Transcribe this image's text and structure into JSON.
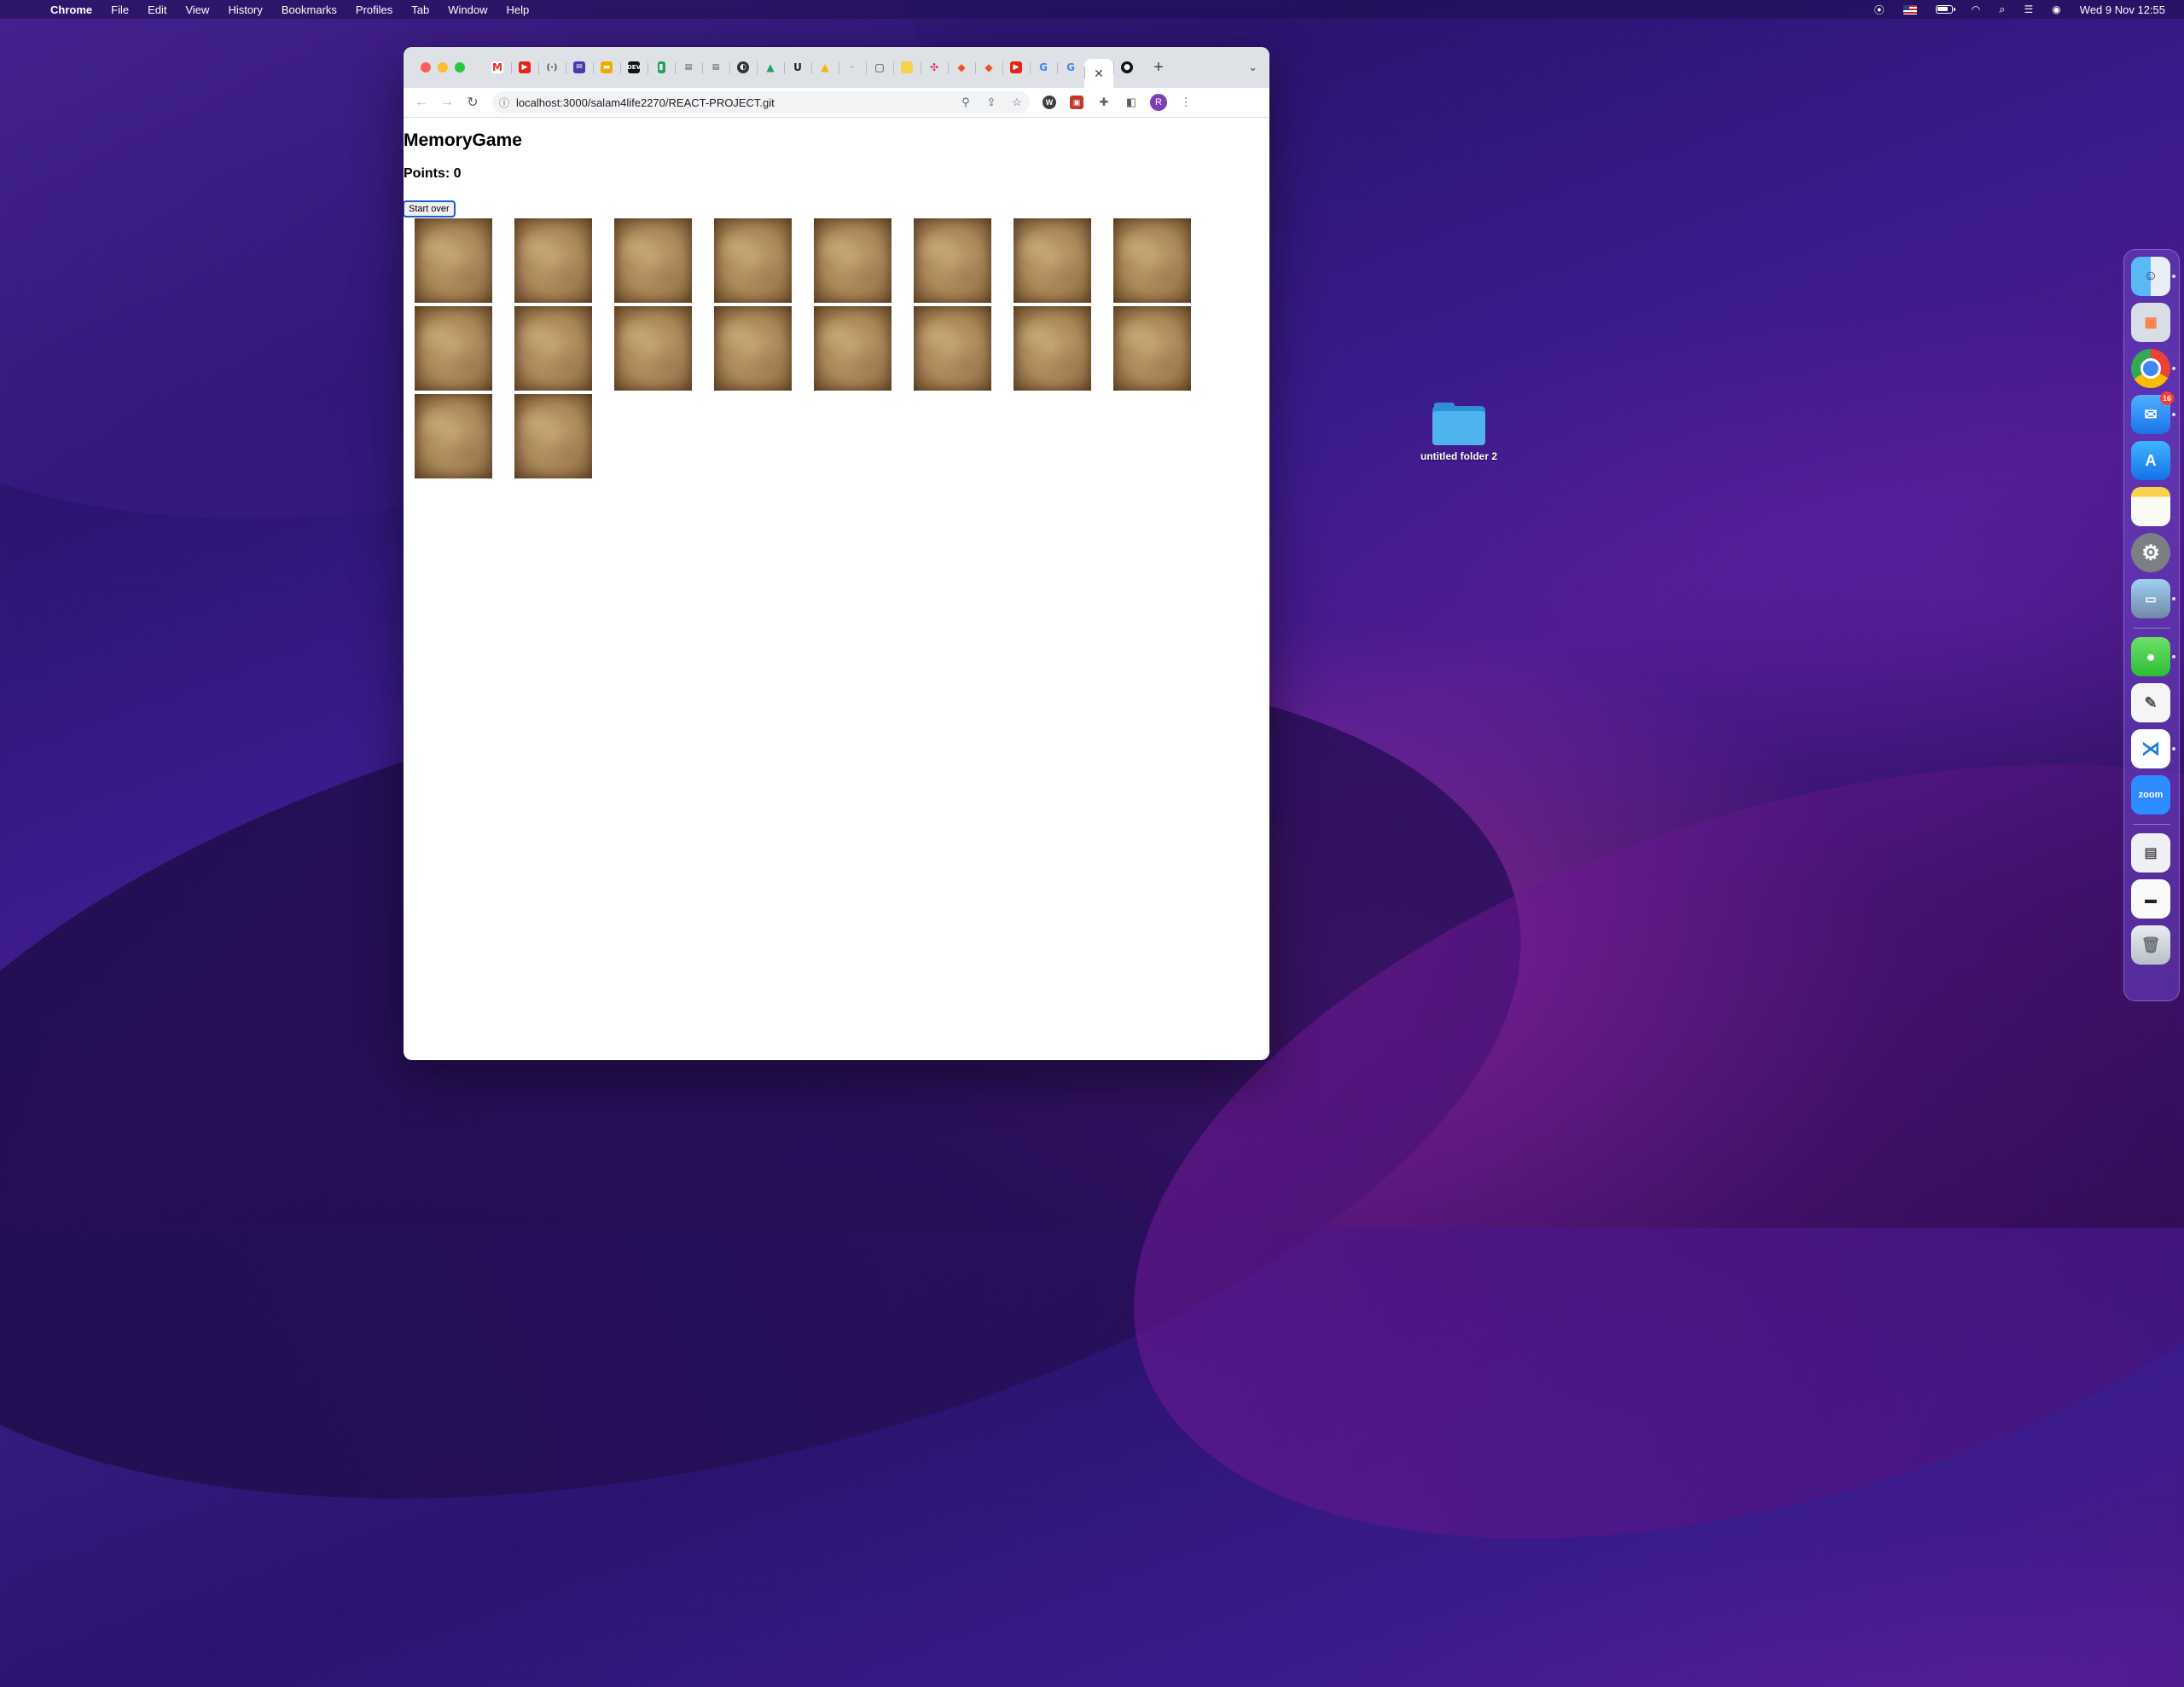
{
  "menubar": {
    "app_name": "Chrome",
    "menus": [
      "File",
      "Edit",
      "View",
      "History",
      "Bookmarks",
      "Profiles",
      "Tab",
      "Window",
      "Help"
    ],
    "clock": "Wed 9 Nov  12:55"
  },
  "browser": {
    "url": "localhost:3000/salam4life2270/REACT-PROJECT.git",
    "profile_initial": "R",
    "tab_favicons": [
      "gmail",
      "youtube",
      "code",
      "mail",
      "yellow-app",
      "dev",
      "sheets",
      "docs",
      "docs",
      "circle",
      "drive",
      "u-app",
      "drive",
      "blank",
      "square",
      "yellow-square",
      "slack",
      "figma",
      "figma",
      "youtube",
      "google",
      "google",
      "github"
    ]
  },
  "page": {
    "title": "MemoryGame",
    "points": "Points: 0",
    "start_over_label": "Start over",
    "card_count": 18
  },
  "desktop": {
    "folder_label": "untitled folder 2"
  },
  "dock": {
    "apps": [
      "Finder",
      "Launchpad",
      "Chrome",
      "Mail",
      "App Store",
      "Notes",
      "System Preferences",
      "Preview",
      "Messages",
      "TextEdit",
      "VS Code",
      "Zoom",
      "Documents",
      "Screenshot",
      "Trash"
    ],
    "mail_badge": "16",
    "zoom_label": "zoom"
  }
}
